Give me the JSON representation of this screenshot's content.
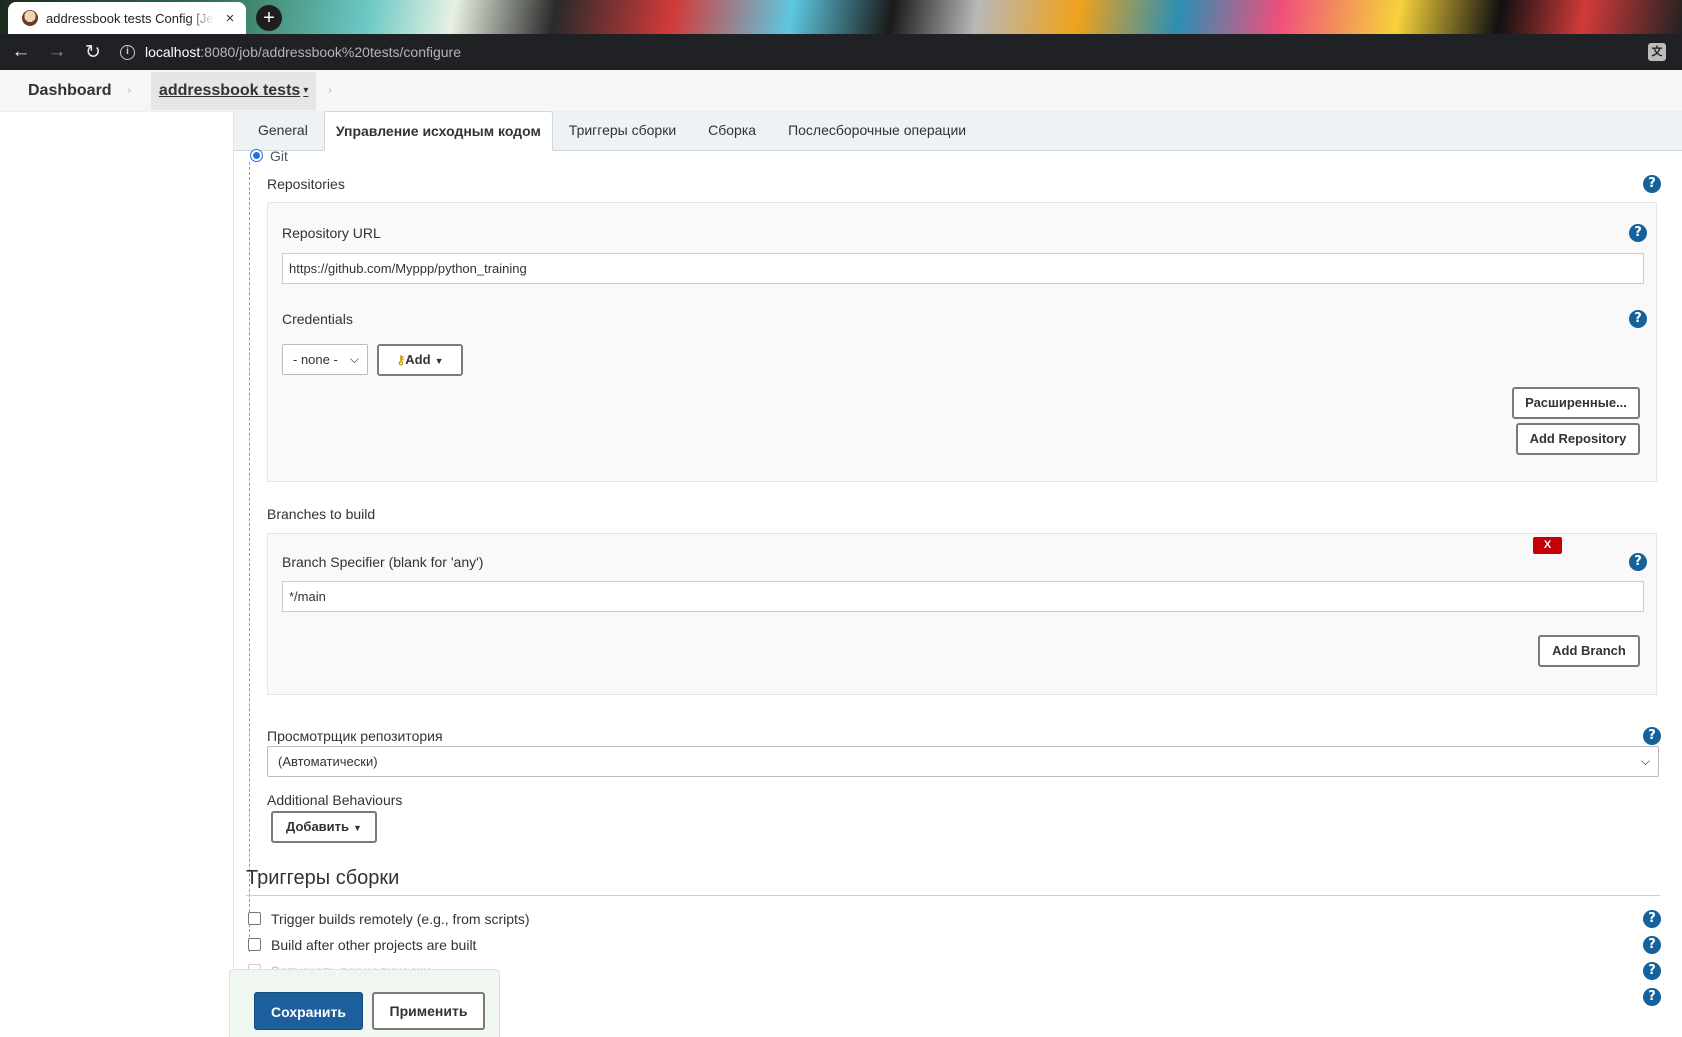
{
  "browser": {
    "tab_title": "addressbook tests Config [Jenkins]",
    "tab_close": "×",
    "new_tab": "+",
    "url_host": "localhost",
    "url_rest": ":8080/job/addressbook%20tests/configure",
    "back": "←",
    "forward": "→",
    "reload": "↻",
    "info": "i",
    "translate": "文"
  },
  "breadcrumb": {
    "dashboard": "Dashboard",
    "job": "addressbook tests",
    "separator": "›",
    "caret": "▾"
  },
  "tabs": [
    {
      "label": "General"
    },
    {
      "label": "Управление исходным кодом"
    },
    {
      "label": "Триггеры сборки"
    },
    {
      "label": "Сборка"
    },
    {
      "label": "Послесборочные операции"
    }
  ],
  "scm": {
    "radio_label": "Git",
    "repositories_label": "Repositories",
    "repo_url_label": "Repository URL",
    "repo_url_value": "https://github.com/Myppp/python_training",
    "credentials_label": "Credentials",
    "credentials_selected": "- none -",
    "add_label": "Add",
    "advanced_label": "Расширенные...",
    "add_repository_label": "Add Repository",
    "branches_label": "Branches to build",
    "branch_specifier_label": "Branch Specifier (blank for 'any')",
    "branch_value": "*/main",
    "delete_label": "X",
    "add_branch_label": "Add Branch",
    "browser_label": "Просмотрщик репозитория",
    "browser_selected": "(Автоматически)",
    "additional_label": "Additional Behaviours",
    "add_behaviour_label": "Добавить"
  },
  "triggers": {
    "title": "Триггеры сборки",
    "items": [
      {
        "label": "Trigger builds remotely (e.g., from scripts)"
      },
      {
        "label": "Build after other projects are built"
      },
      {
        "label": "Запускать периодически"
      },
      {
        "label": ""
      }
    ]
  },
  "help_symbol": "?",
  "footer": {
    "save_label": "Сохранить",
    "apply_label": "Применить"
  },
  "colors": {
    "help_blue": "#14619b",
    "primary": "#1d5f9c",
    "delete_red": "#c4000a"
  }
}
